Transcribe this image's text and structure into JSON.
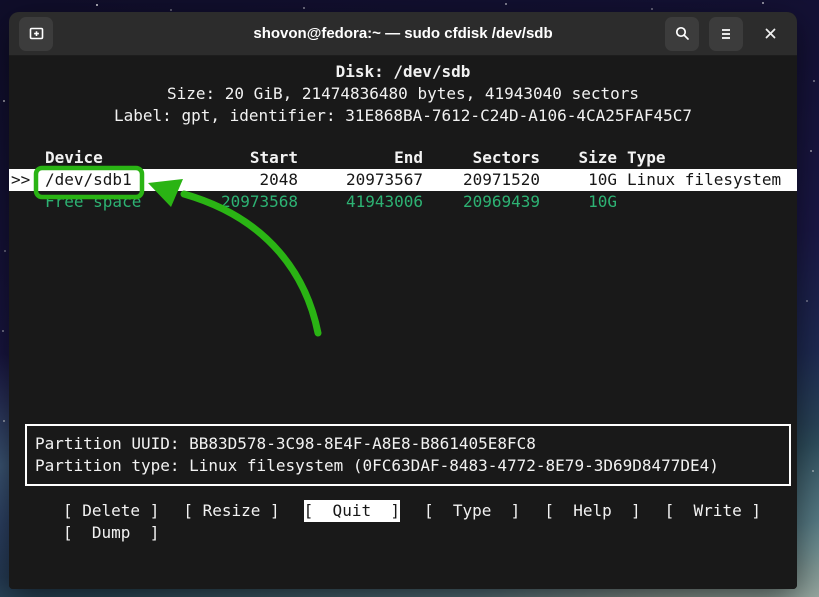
{
  "window": {
    "title": "shovon@fedora:~ — sudo cfdisk /dev/sdb",
    "icons": {
      "new_tab": "tab-new-icon",
      "search": "search-icon",
      "menu": "hamburger-menu-icon",
      "close": "close-icon"
    }
  },
  "disk_info": {
    "title": "Disk: /dev/sdb",
    "size_line": "Size: 20 GiB, 21474836480 bytes, 41943040 sectors",
    "label_line": "Label: gpt, identifier: 31E868BA-7612-C24D-A106-4CA25FAF45C7"
  },
  "partition_table": {
    "columns": [
      "Device",
      "Start",
      "End",
      "Sectors",
      "Size",
      "Type"
    ],
    "rows": [
      {
        "marker": ">>",
        "device": "/dev/sdb1",
        "start": "2048",
        "end": "20973567",
        "sectors": "20971520",
        "size": "10G",
        "type": "Linux filesystem",
        "selected": true
      },
      {
        "marker": "",
        "device": "Free space",
        "start": "20973568",
        "end": "41943006",
        "sectors": "20969439",
        "size": "10G",
        "type": "",
        "selected": false
      }
    ]
  },
  "details_box": {
    "line1": "Partition UUID: BB83D578-3C98-8E4F-A8E8-B861405E8FC8",
    "line2": "Partition type: Linux filesystem (0FC63DAF-8483-4772-8E79-3D69D8477DE4)"
  },
  "menu": {
    "row1": [
      {
        "label": "[ Delete ]",
        "selected": false
      },
      {
        "label": "[ Resize ]",
        "selected": false
      },
      {
        "label": "[  Quit  ]",
        "selected": true
      },
      {
        "label": "[  Type  ]",
        "selected": false
      },
      {
        "label": "[  Help  ]",
        "selected": false
      },
      {
        "label": "[  Write ]",
        "selected": false
      }
    ],
    "row2": [
      {
        "label": "[  Dump  ]",
        "selected": false
      }
    ]
  },
  "annotation": {
    "highlight_target": "/dev/sdb1",
    "color": "#2ab414",
    "shape": "box-around-device-plus-curved-arrow"
  },
  "colors": {
    "terminal_background": "#191919",
    "terminal_foreground": "#f2f2f2",
    "terminal_green": "#2db273",
    "selection_background": "#ffffff",
    "selection_foreground": "#171717",
    "titlebar_background": "#2c2c2c",
    "titlebar_button_background": "#3c3c3c",
    "annotation_green": "#2ab414"
  }
}
